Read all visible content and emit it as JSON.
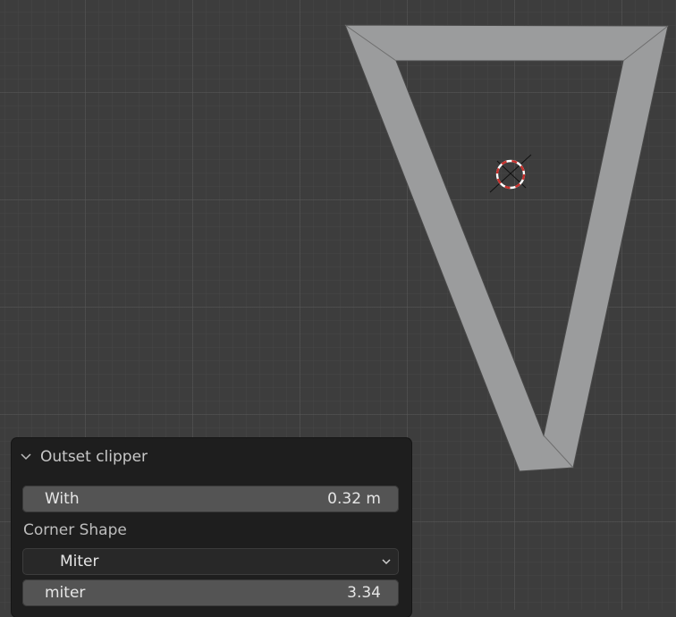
{
  "panel": {
    "title": "Outset clipper",
    "width_label": "With",
    "width_value": "0.32 m",
    "corner_shape_label": "Corner Shape",
    "corner_shape_value": "Miter",
    "miter_label": "miter",
    "miter_value": "3.34"
  },
  "icons": {
    "collapse": "chevron-down-icon",
    "dropdown": "chevron-down-icon",
    "cursor": "3d-cursor-icon"
  },
  "colors": {
    "viewport_bg": "#3d3d3d",
    "mesh_face": "#9b9c9d",
    "panel_bg": "#1e1e1e",
    "field_bg": "#545454",
    "cursor_red": "#c8302c"
  }
}
